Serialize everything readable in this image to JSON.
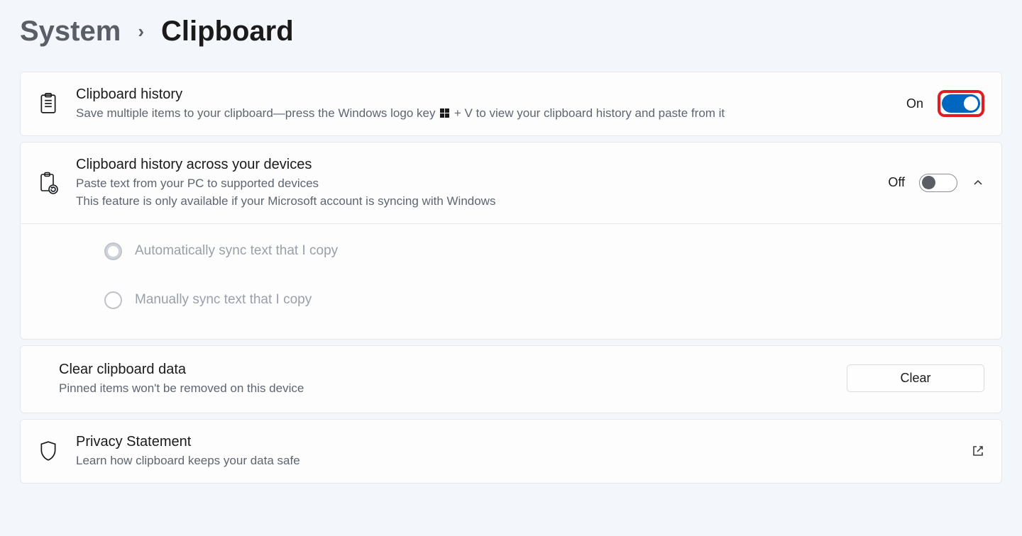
{
  "breadcrumb": {
    "parent": "System",
    "current": "Clipboard"
  },
  "history": {
    "title": "Clipboard history",
    "desc_pre": "Save multiple items to your clipboard—press the Windows logo key ",
    "desc_post": " + V to view your clipboard history and paste from it",
    "state": "On"
  },
  "sync": {
    "title": "Clipboard history across your devices",
    "desc1": "Paste text from your PC to supported devices",
    "desc2": "This feature is only available if your Microsoft account is syncing with Windows",
    "state": "Off",
    "opt_auto": "Automatically sync text that I copy",
    "opt_manual": "Manually sync text that I copy"
  },
  "clear": {
    "title": "Clear clipboard data",
    "desc": "Pinned items won't be removed on this device",
    "button": "Clear"
  },
  "privacy": {
    "title": "Privacy Statement",
    "desc": "Learn how clipboard keeps your data safe"
  }
}
